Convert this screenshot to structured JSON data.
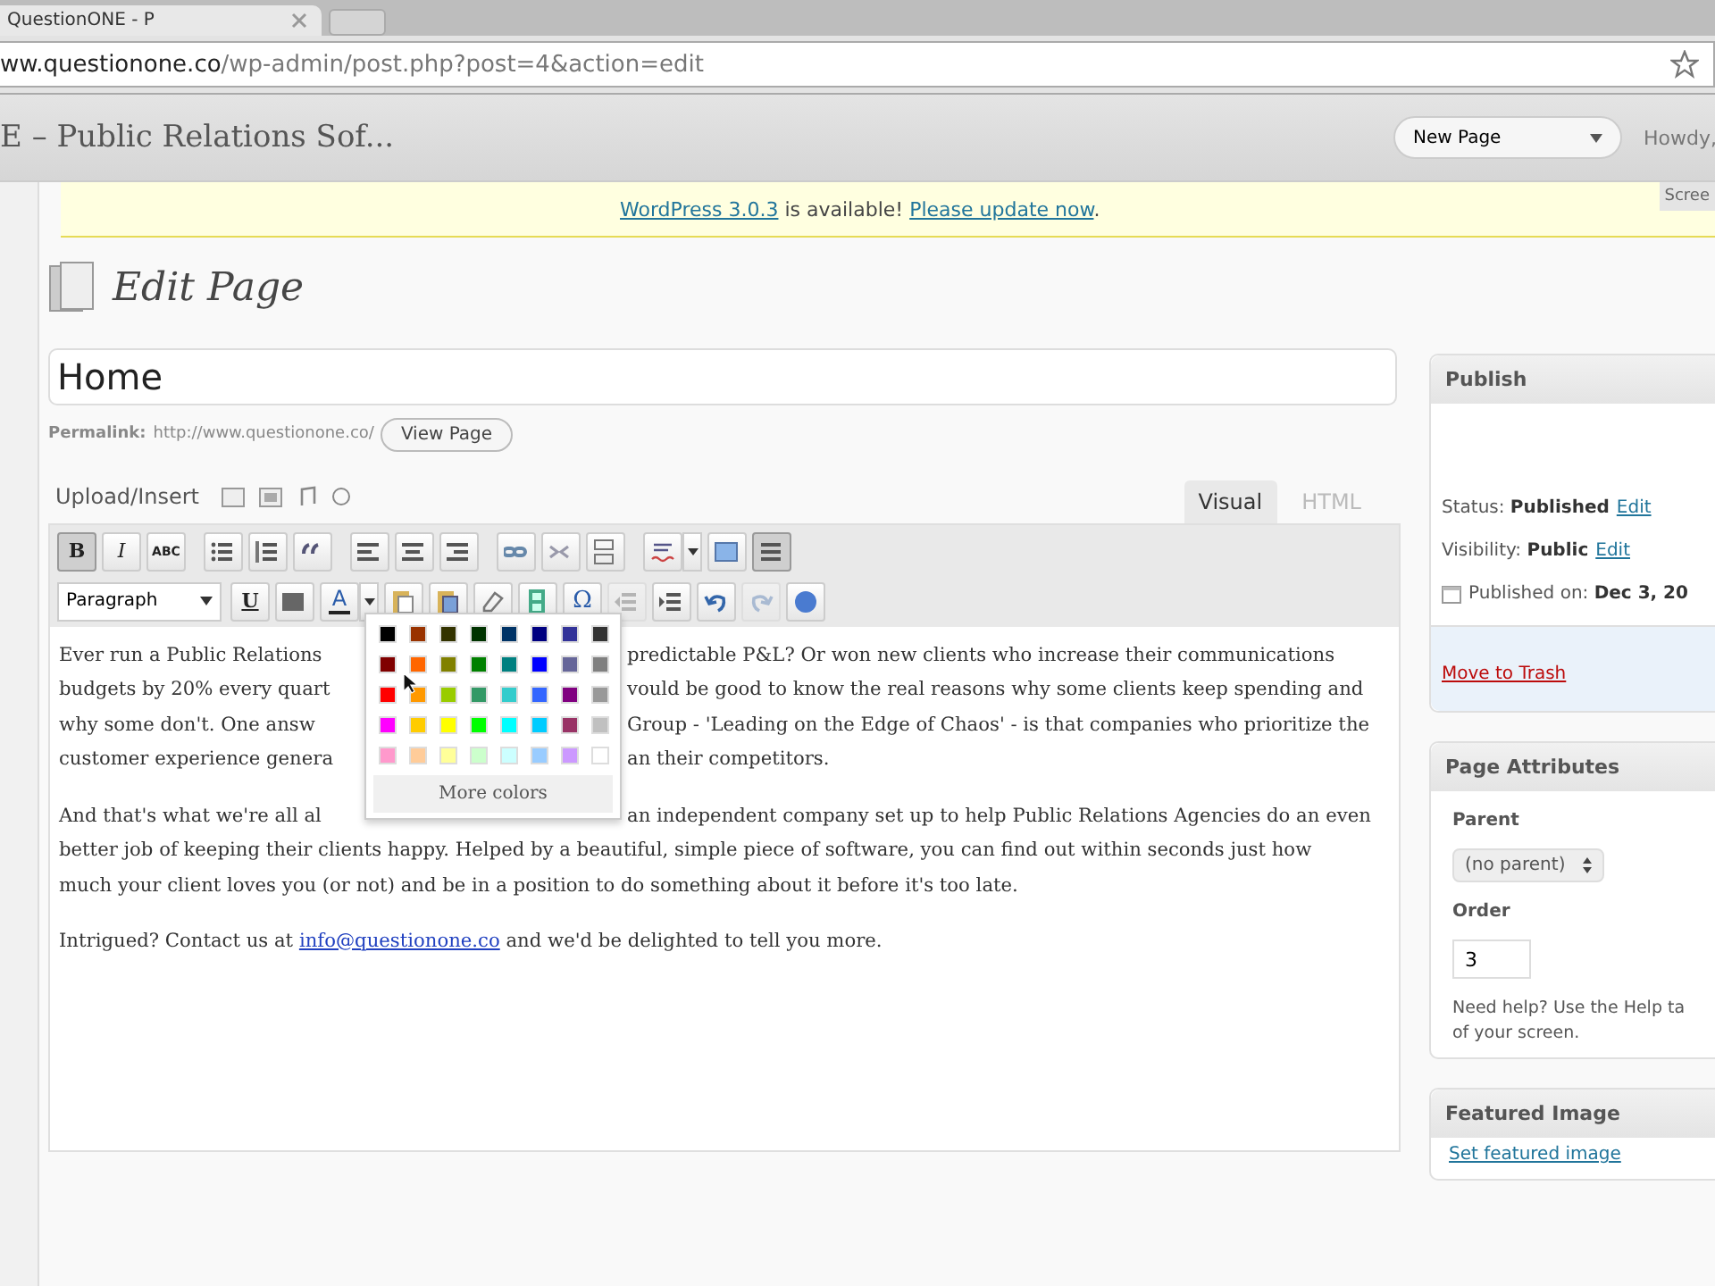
{
  "browser": {
    "tab_title": "QuestionONE - P",
    "url_host": "ww.questionone.co",
    "url_path": "/wp-admin/post.php?post=4&action=edit"
  },
  "header": {
    "site_title": "E – Public Relations Sof...",
    "new_button": "New Page",
    "howdy": "Howdy,"
  },
  "notice": {
    "link1": "WordPress 3.0.3",
    "text": "is available!",
    "link2": "Please update now",
    "end": ".",
    "screen_tab": "Scree"
  },
  "page_title": "Edit Page",
  "post_title": "Home",
  "permalink": {
    "label": "Permalink:",
    "url": "http://www.questionone.co/",
    "button": "View Page"
  },
  "upload_label": "Upload/Insert",
  "editor_tabs": [
    {
      "label": "Visual",
      "selected": true
    },
    {
      "label": "HTML",
      "selected": false
    }
  ],
  "toolbar_rows": [
    [
      {
        "kind": "bold",
        "label": "B",
        "pressed": true,
        "disabled": false
      },
      {
        "kind": "italic",
        "label": "I",
        "pressed": false,
        "disabled": false
      },
      {
        "kind": "strike",
        "label": "ABC",
        "pressed": false,
        "disabled": false
      },
      {
        "kind": "bullets",
        "pressed": false,
        "disabled": false
      },
      {
        "kind": "numbers",
        "pressed": false,
        "disabled": false
      },
      {
        "kind": "quote",
        "pressed": false,
        "disabled": false
      },
      {
        "kind": "align-left",
        "pressed": false,
        "disabled": false
      },
      {
        "kind": "align-center",
        "pressed": false,
        "disabled": false
      },
      {
        "kind": "align-right",
        "pressed": false,
        "disabled": false
      },
      {
        "kind": "link",
        "pressed": false,
        "disabled": false
      },
      {
        "kind": "unlink",
        "pressed": false,
        "disabled": false
      },
      {
        "kind": "more",
        "pressed": false,
        "disabled": false
      },
      {
        "kind": "spell",
        "pressed": false,
        "disabled": false
      },
      {
        "kind": "fullscreen",
        "pressed": false,
        "disabled": false
      },
      {
        "kind": "kitchen",
        "pressed": true,
        "disabled": false
      }
    ],
    [
      {
        "kind": "format",
        "label": "Paragraph"
      },
      {
        "kind": "underline",
        "label": "U",
        "pressed": false,
        "disabled": false
      },
      {
        "kind": "justify",
        "pressed": false,
        "disabled": false
      },
      {
        "kind": "forecolor",
        "label": "A",
        "pressed": false,
        "disabled": false
      },
      {
        "kind": "paste-text",
        "pressed": false,
        "disabled": false
      },
      {
        "kind": "paste-word",
        "pressed": false,
        "disabled": false
      },
      {
        "kind": "eraser",
        "pressed": false,
        "disabled": false
      },
      {
        "kind": "media",
        "pressed": false,
        "disabled": false
      },
      {
        "kind": "charmap",
        "label": "Ω",
        "pressed": false,
        "disabled": false
      },
      {
        "kind": "outdent",
        "pressed": false,
        "disabled": true
      },
      {
        "kind": "indent",
        "pressed": false,
        "disabled": false
      },
      {
        "kind": "undo",
        "pressed": false,
        "disabled": false
      },
      {
        "kind": "redo",
        "pressed": false,
        "disabled": true
      },
      {
        "kind": "help",
        "pressed": false,
        "disabled": false
      }
    ]
  ],
  "body": {
    "paragraphs": [
      {
        "lines": [
          {
            "left": "Ever run a Public Relations",
            "right": "predictable P&L?  Or won new clients who increase their communications"
          },
          {
            "left": "budgets by 20% every quart",
            "right": "vould be good to know the real reasons why some clients keep spending and"
          },
          {
            "left": "why some don't.  One answ",
            "right": "Group - 'Leading on the Edge of Chaos' - is that companies who prioritize the"
          },
          {
            "left": "customer experience genera",
            "right": "an their competitors."
          }
        ]
      },
      {
        "lines": [
          {
            "left": "And that's what we're all al",
            "right": "an independent company set up to help Public Relations Agencies do an even"
          },
          {
            "left": "better job of keeping their clients happy.  Helped by a beautiful, simple piece of software, you can find out within seconds just how"
          },
          {
            "left": "much your client loves you (or not) and be in a position to do something about it before it's too late."
          }
        ]
      }
    ],
    "contact": {
      "before": "Intrigued?  Contact us at",
      "link": "info@questionone.co",
      "after": "and we'd be delighted to tell you more."
    }
  },
  "color_picker": {
    "swatches": [
      {
        "color": "#000000"
      },
      {
        "color": "#993300"
      },
      {
        "color": "#333300"
      },
      {
        "color": "#003300"
      },
      {
        "color": "#003366"
      },
      {
        "color": "#000080"
      },
      {
        "color": "#333399"
      },
      {
        "color": "#333333"
      },
      {
        "color": "#800000"
      },
      {
        "color": "#ff6600"
      },
      {
        "color": "#808000"
      },
      {
        "color": "#008000"
      },
      {
        "color": "#008080"
      },
      {
        "color": "#0000ff"
      },
      {
        "color": "#666699"
      },
      {
        "color": "#808080"
      },
      {
        "color": "#ff0000"
      },
      {
        "color": "#ff9900"
      },
      {
        "color": "#99cc00"
      },
      {
        "color": "#339966"
      },
      {
        "color": "#33cccc"
      },
      {
        "color": "#3366ff"
      },
      {
        "color": "#800080"
      },
      {
        "color": "#999999"
      },
      {
        "color": "#ff00ff"
      },
      {
        "color": "#ffcc00"
      },
      {
        "color": "#ffff00"
      },
      {
        "color": "#00ff00"
      },
      {
        "color": "#00ffff"
      },
      {
        "color": "#00ccff"
      },
      {
        "color": "#993366"
      },
      {
        "color": "#c0c0c0"
      },
      {
        "color": "#ff99cc"
      },
      {
        "color": "#ffcc99"
      },
      {
        "color": "#ffff99"
      },
      {
        "color": "#ccffcc"
      },
      {
        "color": "#ccffff"
      },
      {
        "color": "#99ccff"
      },
      {
        "color": "#cc99ff"
      },
      {
        "color": "#ffffff"
      }
    ],
    "more": "More colors"
  },
  "publish": {
    "title": "Publish",
    "status": "Status: **Published**",
    "status_edit": "Edit",
    "visibility": "Visibility: **Public**",
    "visibility_edit": "Edit",
    "published_on": "Published on: **Dec 3, 20**",
    "trash": "Move to Trash"
  },
  "page_attributes": {
    "title": "Page Attributes",
    "parent_label": "Parent",
    "parent_value": "(no parent)",
    "order_label": "Order",
    "order_value": "3",
    "help_lines": [
      "Need help? Use the Help ta",
      "of your screen."
    ]
  },
  "featured": {
    "title": "Featured Image",
    "link": "Set featured image"
  }
}
